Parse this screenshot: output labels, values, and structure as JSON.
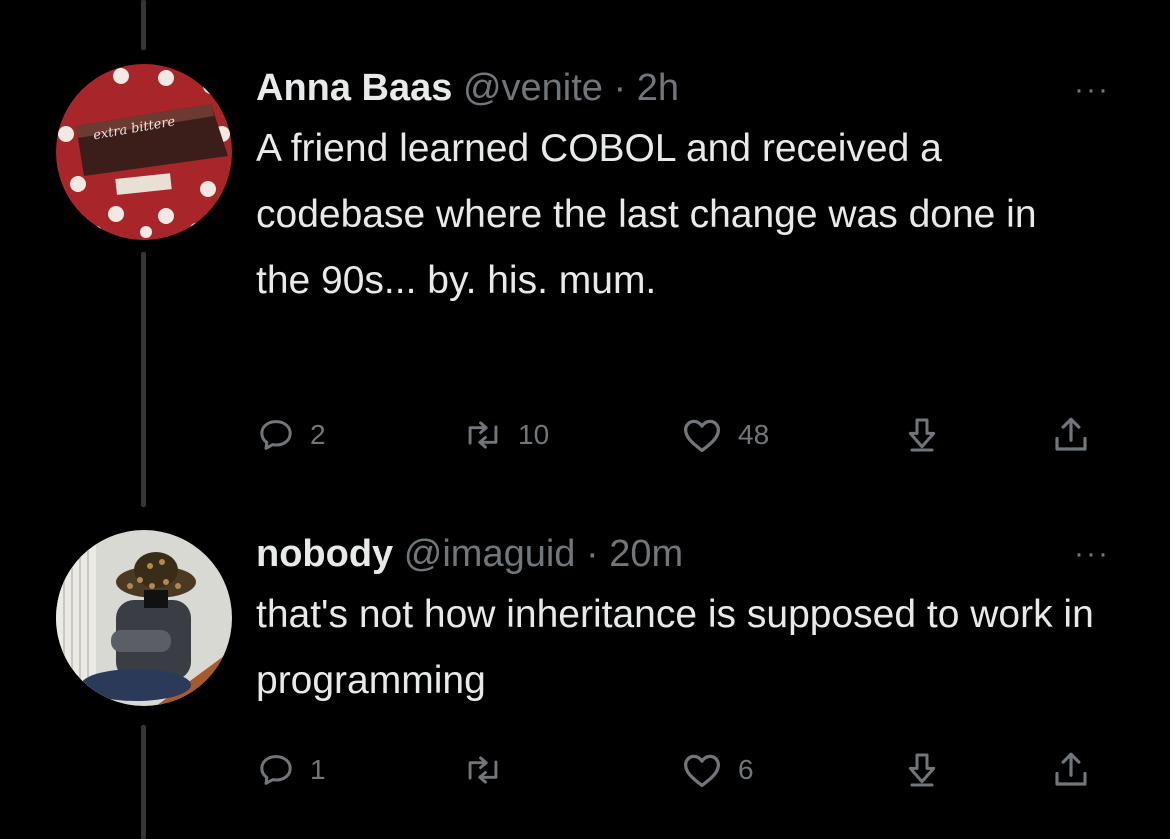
{
  "tweets": [
    {
      "author_name": "Anna Baas",
      "handle": "@venite",
      "separator": "·",
      "time": "2h",
      "text": "A friend learned COBOL and received a codebase where the last change was done in the 90s... by. his. mum.",
      "replies": "2",
      "retweets": "10",
      "likes": "48",
      "avatar_icon": "chocolate-bar-avatar",
      "avatar_text": "extra bittere"
    },
    {
      "author_name": "nobody",
      "handle": "@imaguid",
      "separator": "·",
      "time": "20m",
      "text": "that's not how inheritance is supposed to work in programming",
      "replies": "1",
      "retweets": "",
      "likes": "6",
      "avatar_icon": "person-with-hat-avatar"
    }
  ],
  "more_label": "···",
  "colors": {
    "background": "#000000",
    "text": "#e7e9ea",
    "muted": "#71767b",
    "thread_line": "#333639"
  }
}
